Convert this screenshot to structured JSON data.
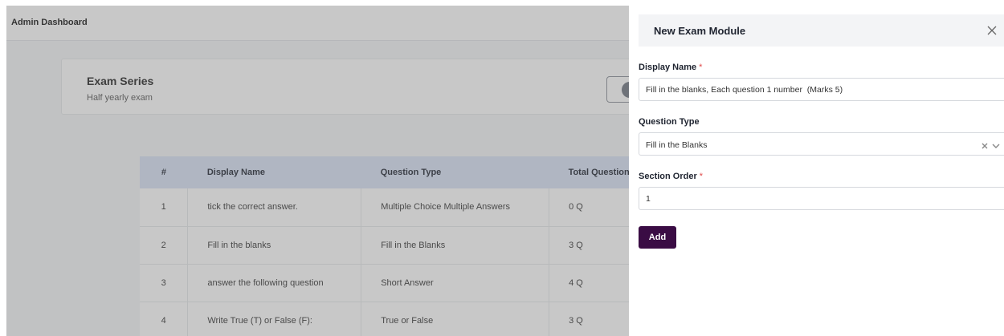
{
  "topbar": {
    "title": "Admin Dashboard"
  },
  "series": {
    "title": "Exam Series",
    "subtitle": "Half yearly exam"
  },
  "table": {
    "headers": [
      "#",
      "Display Name",
      "Question Type",
      "Total Question"
    ],
    "rows": [
      {
        "num": "1",
        "name": "tick the correct answer.",
        "type": "Multiple Choice Multiple Answers",
        "total": "0 Q"
      },
      {
        "num": "2",
        "name": "Fill in the blanks",
        "type": "Fill in the Blanks",
        "total": "3 Q"
      },
      {
        "num": "3",
        "name": "answer the following question",
        "type": "Short Answer",
        "total": "4 Q"
      },
      {
        "num": "4",
        "name": "Write True (T) or False (F):",
        "type": "True or False",
        "total": "3 Q"
      }
    ]
  },
  "drawer": {
    "title": "New Exam Module",
    "display_name": {
      "label": "Display Name",
      "required": "*",
      "value": "Fill in the blanks, Each question 1 number  (Marks 5)"
    },
    "question_type": {
      "label": "Question Type",
      "value": "Fill in the Blanks"
    },
    "section_order": {
      "label": "Section Order",
      "required": "*",
      "value": "1"
    },
    "add_label": "Add"
  },
  "icons": {
    "close": "close-icon",
    "clear": "clear-icon",
    "dropdown": "chevron-down-icon"
  },
  "colors": {
    "primary_button": "#3a0c44",
    "table_header": "#d8e3f5",
    "required": "#e04a4a"
  }
}
